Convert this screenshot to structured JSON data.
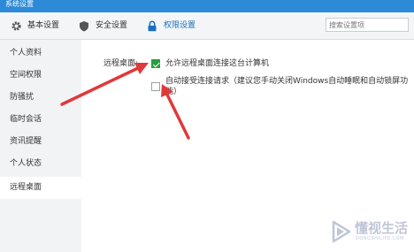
{
  "window": {
    "title": "系统设置"
  },
  "tabs": [
    {
      "label": "基本设置",
      "icon": "gear-icon"
    },
    {
      "label": "安全设置",
      "icon": "shield-icon"
    },
    {
      "label": "权限设置",
      "icon": "lock-icon",
      "active": true
    }
  ],
  "search": {
    "placeholder": "搜索设置项",
    "value": ""
  },
  "sidebar": {
    "items": [
      {
        "label": "个人资料"
      },
      {
        "label": "空间权限"
      },
      {
        "label": "防骚扰"
      },
      {
        "label": "临时会话"
      },
      {
        "label": "资讯提醒"
      },
      {
        "label": "个人状态"
      },
      {
        "label": "远程桌面",
        "active": true
      }
    ]
  },
  "remote_desktop": {
    "label": "远程桌面:",
    "options": [
      {
        "text": "允许远程桌面连接这台计算机",
        "checked": true
      },
      {
        "text": "自动接受连接请求（建议您手动关闭Windows自动睡眠和自动锁屏功能）",
        "checked": false
      }
    ]
  },
  "watermark": {
    "title": "懂视生活",
    "subtitle": "DONGSHILIFE.COM"
  },
  "colors": {
    "accent": "#2d8ad8",
    "active_tab": "#1b6fc2",
    "check": "#25a03f",
    "arrow": "#e0393a"
  }
}
